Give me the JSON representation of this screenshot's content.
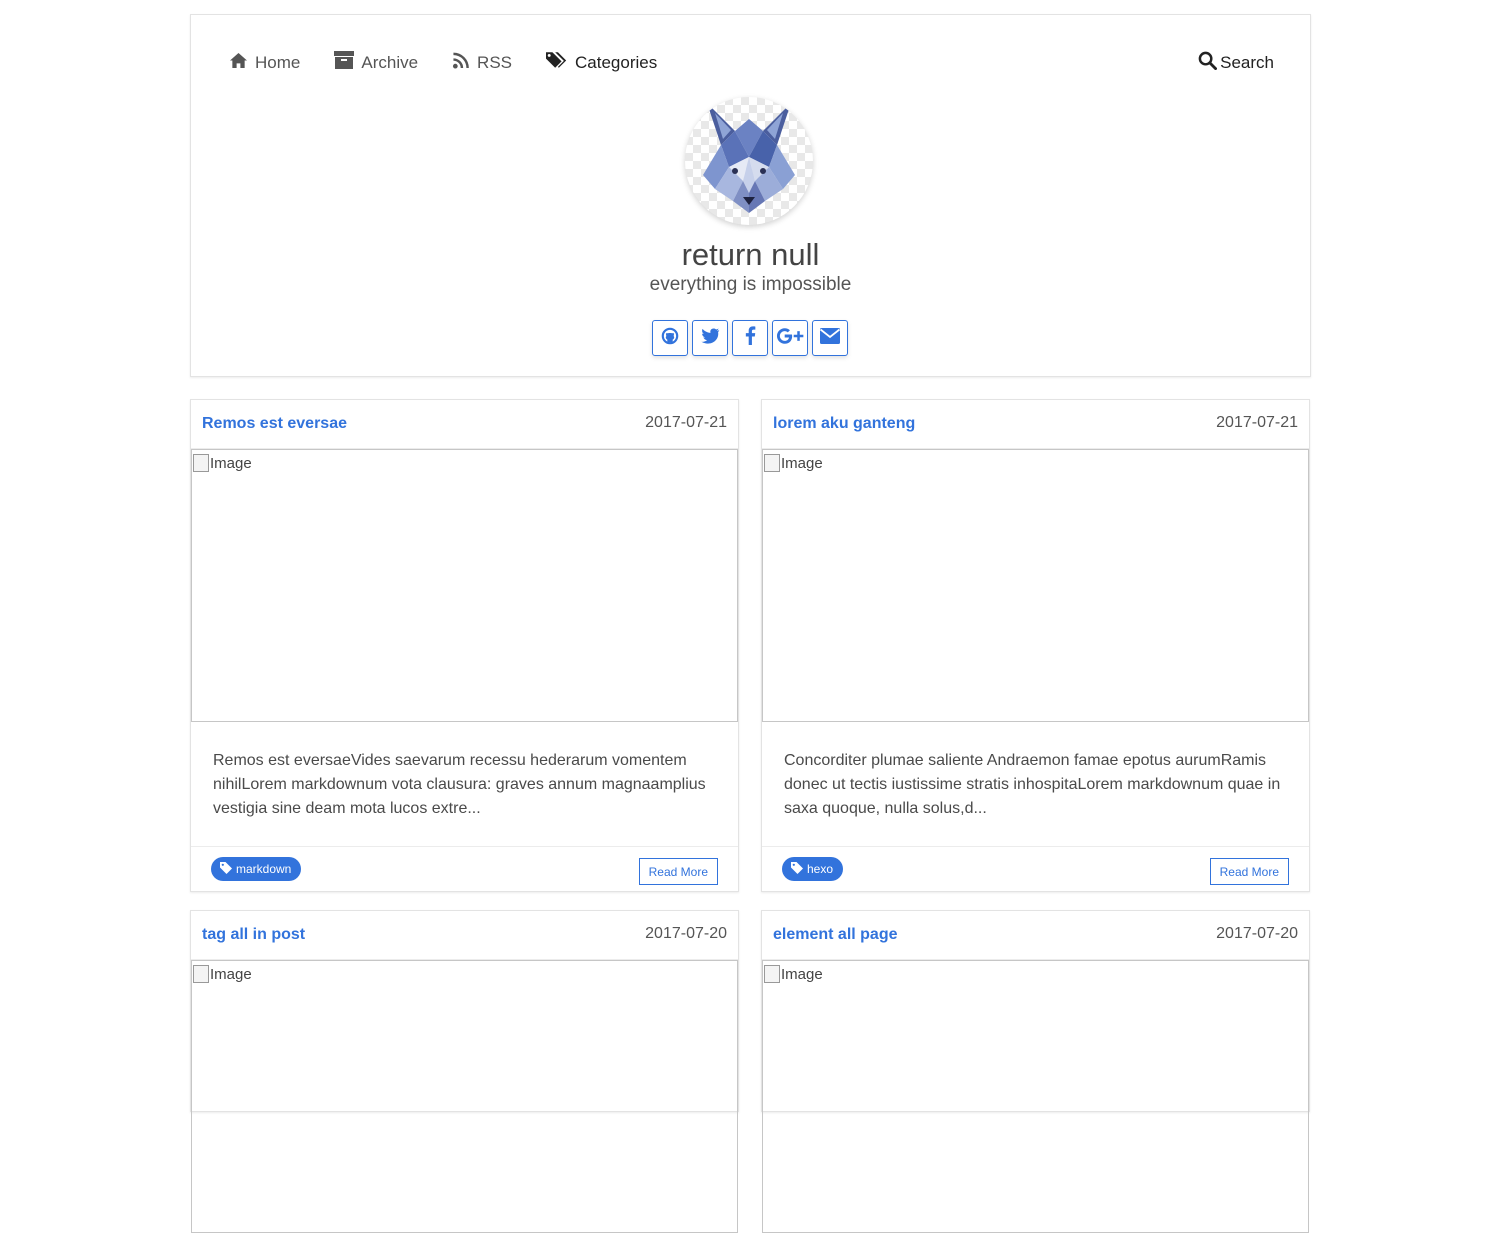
{
  "nav": {
    "items": [
      {
        "label": "Home",
        "icon": "home-icon"
      },
      {
        "label": "Archive",
        "icon": "archive-icon"
      },
      {
        "label": "RSS",
        "icon": "rss-icon"
      },
      {
        "label": "Categories",
        "icon": "tags-icon"
      }
    ],
    "search_label": "Search"
  },
  "profile": {
    "title": "return null",
    "subtitle": "everything is impossible",
    "social": [
      "github-icon",
      "twitter-icon",
      "facebook-icon",
      "google-plus-icon",
      "envelope-icon"
    ]
  },
  "colors": {
    "accent": "#3273dc",
    "text": "#4a4a4a"
  },
  "posts": [
    {
      "title": "Remos est eversae",
      "date": "2017-07-21",
      "image_alt": "Image",
      "excerpt": "Remos est eversaeVides saevarum recessu hederarum vomentem nihilLorem markdownum vota clausura: graves annum magnaamplius vestigia sine deam mota lucos extre...",
      "tag": "markdown",
      "read_more": "Read More"
    },
    {
      "title": "lorem aku ganteng",
      "date": "2017-07-21",
      "image_alt": "Image",
      "excerpt": "Concorditer plumae saliente Andraemon famae epotus aurumRamis donec ut tectis iustissime stratis inhospitaLorem markdownum quae in saxa quoque, nulla solus,d...",
      "tag": "hexo",
      "read_more": "Read More"
    },
    {
      "title": "tag all in post",
      "date": "2017-07-20",
      "image_alt": "Image"
    },
    {
      "title": "element all page",
      "date": "2017-07-20",
      "image_alt": "Image"
    }
  ]
}
